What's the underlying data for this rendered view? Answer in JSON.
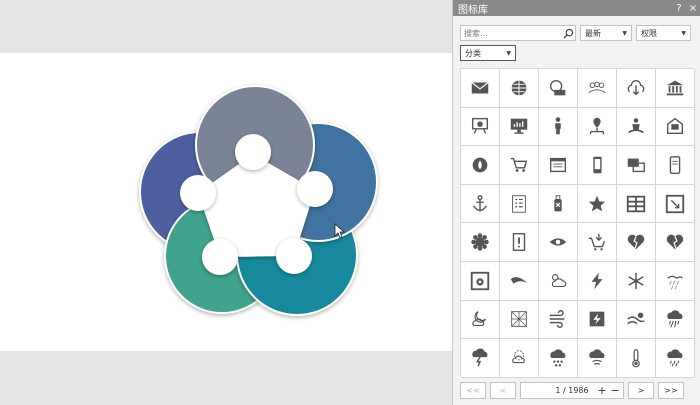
{
  "panel": {
    "title": "图标库",
    "help_label": "?",
    "close_label": "×"
  },
  "search": {
    "placeholder": "搜索..."
  },
  "sort": {
    "selected": "最新"
  },
  "permission": {
    "selected": "权限"
  },
  "category": {
    "selected": "分类"
  },
  "icons": [
    "mail-icon",
    "global-network-icon",
    "www-laptop-icon",
    "people-network-icon",
    "cloud-download-icon",
    "bank-building-icon",
    "presentation-chart-icon",
    "monitor-chart-icon",
    "businessman-icon",
    "org-location-icon",
    "meditation-person-icon",
    "mail-box-icon",
    "flower-badge-icon",
    "shopping-cart-icon",
    "web-page-icon",
    "mobile-phone-icon",
    "chat-windows-icon",
    "smartphone-icon",
    "anchor-icon",
    "checklist-icon",
    "usb-drive-icon",
    "star-icon",
    "table-icon",
    "resize-window-icon",
    "gear-flower-icon",
    "document-alert-icon",
    "eye-icon",
    "cart-arrow-icon",
    "broken-heart-icon",
    "broken-heart-2-icon",
    "settings-window-icon",
    "leaf-icon",
    "partly-cloudy-icon",
    "lightning-icon",
    "snowflake-icon",
    "windy-rain-icon",
    "moon-cloud-icon",
    "snow-pattern-icon",
    "wind-icon",
    "storm-map-icon",
    "wind-sun-icon",
    "heavy-rain-icon",
    "thunder-rain-icon",
    "sun-rain-icon",
    "snow-cloud-icon",
    "fog-cloud-icon",
    "thermometer-icon",
    "rain-cloud-icon"
  ],
  "pager": {
    "first_label": "<<",
    "prev_label": "<",
    "page_text": "1 / 1986",
    "plus_label": "+",
    "minus_label": "−",
    "next_label": ">",
    "last_label": ">>"
  },
  "colors": {
    "petal_slate": "#7a8496",
    "petal_blue": "#41739f",
    "petal_teal": "#188a9c",
    "petal_green": "#40a38d",
    "petal_indigo": "#4e5f9f",
    "icon": "#555555"
  }
}
